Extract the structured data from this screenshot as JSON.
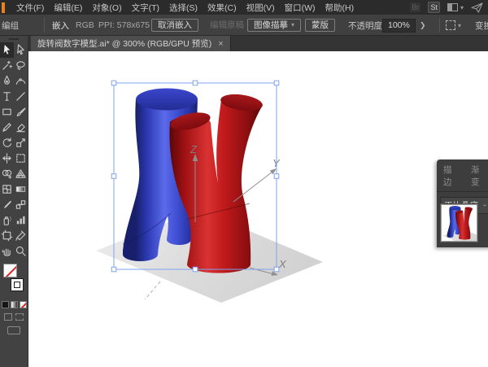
{
  "menu": {
    "items": [
      "文件(F)",
      "编辑(E)",
      "对象(O)",
      "文字(T)",
      "选择(S)",
      "效果(C)",
      "视图(V)",
      "窗口(W)",
      "帮助(H)"
    ],
    "right_icons": {
      "bridge": "Br",
      "stock": "St"
    }
  },
  "control_bar": {
    "selection_type": "编组",
    "embed_label": "嵌入",
    "color_mode": "RGB",
    "ppi": "PPI: 578x675",
    "unembed_button": "取消嵌入",
    "edit_original_button": "编辑原稿",
    "image_trace_button": "图像描摹",
    "mask_button": "蒙版",
    "opacity_label": "不透明度:",
    "opacity_value": "100%",
    "opacity_more": "❯",
    "transform_label": "变换"
  },
  "document_tab": {
    "title": "旋转阀数字模型.ai* @ 300% (RGB/GPU 预览)",
    "close": "×"
  },
  "toolbar": {
    "selected_tool": "selection",
    "tools": [
      "selection",
      "direct-selection",
      "magic-wand",
      "lasso",
      "pen",
      "curvature",
      "type",
      "line-segment",
      "rectangle",
      "paintbrush",
      "pencil",
      "eraser",
      "rotate",
      "scale",
      "width",
      "free-transform",
      "shape-builder",
      "perspective-grid",
      "mesh",
      "gradient",
      "eyedropper",
      "blend",
      "symbol-sprayer",
      "column-graph",
      "artboard",
      "slice",
      "hand",
      "zoom"
    ],
    "fill": "none",
    "stroke": "white"
  },
  "transparency_panel": {
    "tabs": [
      "描边",
      "渐变"
    ],
    "blend_mode": "正片叠底"
  },
  "artwork": {
    "description": "3D model of interlocking blue and red Y-shaped tubes on gray ground plane, selected with bounding box",
    "axes": {
      "x": "X",
      "y": "Y",
      "z": "Z"
    },
    "colors": {
      "blue": "#3240c0",
      "red": "#c01418",
      "plane": "#dedede",
      "selection_box": "#7ea3f0"
    }
  }
}
